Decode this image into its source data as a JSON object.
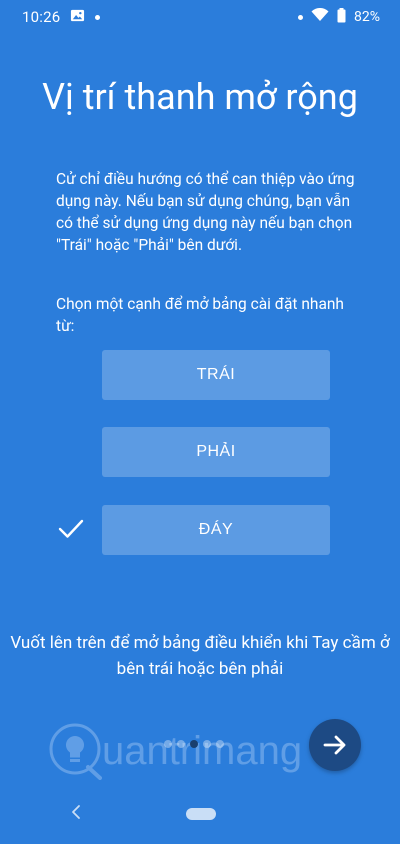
{
  "status_bar": {
    "time": "10:26",
    "battery": "82%",
    "icons": [
      "image-icon",
      "notification-dot-icon",
      "wifi-icon",
      "battery-icon"
    ]
  },
  "title": "Vị trí thanh mở rộng",
  "description": "Cử chỉ điều hướng có thể can thiệp vào ứng dụng này. Nếu bạn sử dụng chúng, bạn vẫn có thể sử dụng ứng dụng này nếu bạn chọn \"Trái\" hoặc \"Phải\" bên dưới.",
  "prompt": "Chọn một cạnh để mở bảng cài đặt nhanh từ:",
  "options": {
    "left": "TRÁI",
    "right": "PHẢI",
    "bottom": "ĐÁY",
    "selected": "bottom"
  },
  "footer_text": "Vuốt lên trên để mở bảng điều khiển khi Tay cầm ở bên trái hoặc bên phải",
  "pager": {
    "total": 5,
    "active_index": 2
  },
  "watermark": "uantrimang",
  "colors": {
    "background": "#2b7ddb",
    "button_fill": "rgba(255,255,255,0.23)",
    "next_button": "#1d4a84",
    "text": "#ffffff"
  }
}
